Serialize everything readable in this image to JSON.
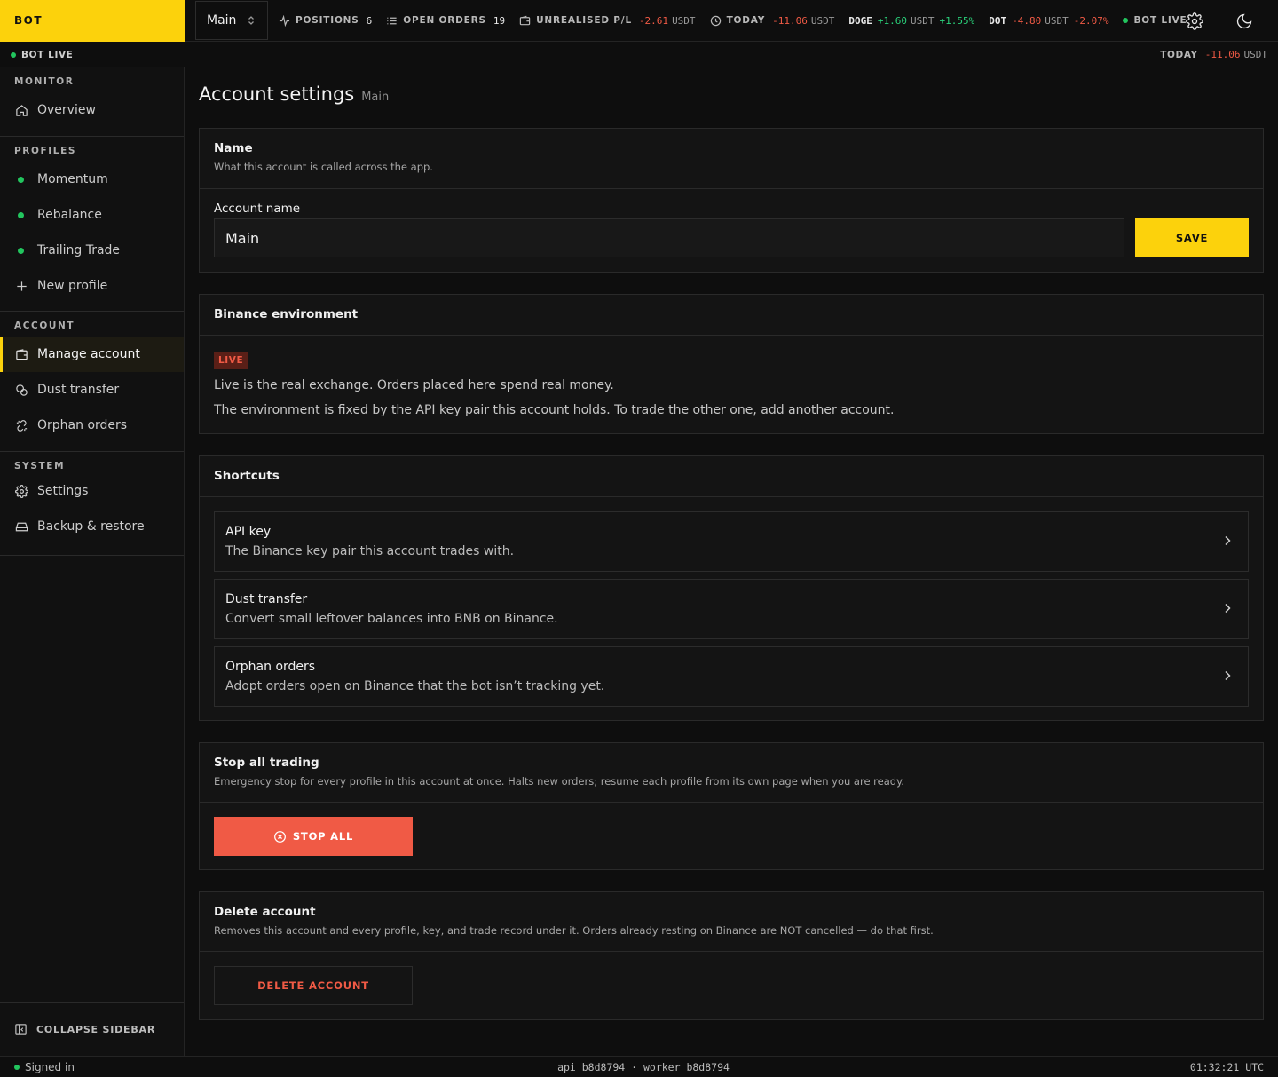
{
  "brand": "BOT",
  "header": {
    "account": "Main",
    "positions": {
      "label": "POSITIONS",
      "value": "6"
    },
    "open_orders": {
      "label": "OPEN ORDERS",
      "value": "19"
    },
    "unrealised": {
      "label": "UNREALISED P/L",
      "value": "-2.61",
      "unit": "USDT"
    },
    "today": {
      "label": "TODAY",
      "value": "-11.06",
      "unit": "USDT"
    },
    "tickers": [
      {
        "symbol": "DOGE",
        "value": "+1.60",
        "unit": "USDT",
        "pct": "+1.55%"
      },
      {
        "symbol": "DOT",
        "value": "-4.80",
        "unit": "USDT",
        "pct": "-2.07%"
      }
    ],
    "bot_status": "BOT LIVE"
  },
  "subbar": {
    "status": "BOT LIVE",
    "today_label": "TODAY",
    "today_value": "-11.06",
    "today_unit": "USDT"
  },
  "sidebar": {
    "monitor": {
      "title": "MONITOR",
      "items": [
        "Overview"
      ]
    },
    "profiles": {
      "title": "PROFILES",
      "items": [
        "Momentum",
        "Rebalance",
        "Trailing Trade"
      ],
      "new_label": "New profile"
    },
    "account": {
      "title": "ACCOUNT",
      "items": [
        "Manage account",
        "Dust transfer",
        "Orphan orders"
      ]
    },
    "system": {
      "title": "SYSTEM",
      "items": [
        "Settings",
        "Backup & restore"
      ]
    },
    "collapse_label": "COLLAPSE SIDEBAR"
  },
  "page": {
    "title": "Account settings",
    "subtitle": "Main"
  },
  "name_card": {
    "title": "Name",
    "description": "What this account is called across the app.",
    "field_label": "Account name",
    "field_value": "Main",
    "save_label": "SAVE"
  },
  "env_card": {
    "title": "Binance environment",
    "badge": "LIVE",
    "line1": "Live is the real exchange. Orders placed here spend real money.",
    "line2": "The environment is fixed by the API key pair this account holds. To trade the other one, add another account."
  },
  "shortcuts": {
    "title": "Shortcuts",
    "items": [
      {
        "title": "API key",
        "desc": "The Binance key pair this account trades with."
      },
      {
        "title": "Dust transfer",
        "desc": "Convert small leftover balances into BNB on Binance."
      },
      {
        "title": "Orphan orders",
        "desc": "Adopt orders open on Binance that the bot isn’t tracking yet."
      }
    ]
  },
  "stop_card": {
    "title": "Stop all trading",
    "description": "Emergency stop for every profile in this account at once. Halts new orders; resume each profile from its own page when you are ready.",
    "button": "STOP ALL"
  },
  "delete_card": {
    "title": "Delete account",
    "description": "Removes this account and every profile, key, and trade record under it. Orders already resting on Binance are NOT cancelled — do that first.",
    "button": "DELETE ACCOUNT"
  },
  "footer": {
    "signed_in": "Signed in",
    "build": "api b8d8794 · worker b8d8794",
    "clock": "01:32:21 UTC"
  },
  "colors": {
    "accent": "#fcd20c",
    "danger": "#f05a45",
    "positive": "#2ad17a",
    "live_dot": "#22c55e",
    "background": "#0e0e0e"
  },
  "icons": {
    "positions": "activity-icon",
    "open_orders": "list-icon",
    "unrealised": "wallet-icon",
    "today": "clock-icon",
    "settings": "gear-icon",
    "theme": "moon-icon"
  }
}
